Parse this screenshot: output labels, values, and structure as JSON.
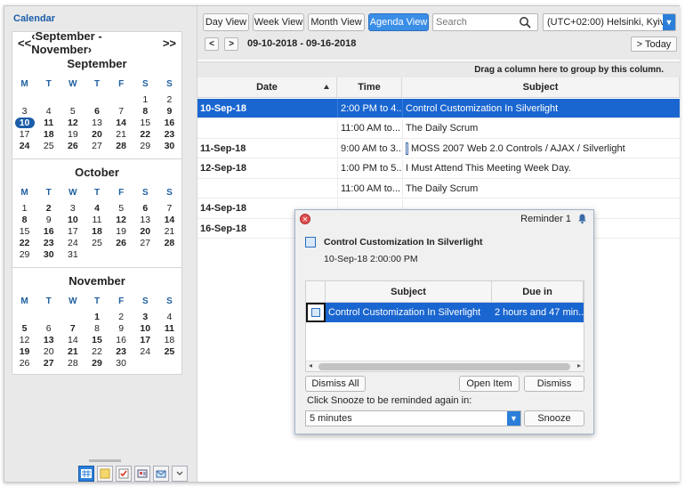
{
  "sidebar": {
    "title": "Calendar",
    "nav_prev": "<<",
    "nav_range": "‹September - November›",
    "nav_next": ">>",
    "dow": [
      "M",
      "T",
      "W",
      "T",
      "F",
      "S",
      "S"
    ],
    "months": [
      {
        "name": "September",
        "days": [
          {
            "t": "",
            "b": false
          },
          {
            "t": "",
            "b": false
          },
          {
            "t": "",
            "b": false
          },
          {
            "t": "",
            "b": false
          },
          {
            "t": "",
            "b": false
          },
          {
            "t": "1",
            "b": false
          },
          {
            "t": "2",
            "b": false
          },
          {
            "t": "3",
            "b": false
          },
          {
            "t": "4",
            "b": false
          },
          {
            "t": "5",
            "b": false
          },
          {
            "t": "6",
            "b": true
          },
          {
            "t": "7",
            "b": false
          },
          {
            "t": "8",
            "b": true
          },
          {
            "t": "9",
            "b": true
          },
          {
            "t": "10",
            "b": true,
            "today": true
          },
          {
            "t": "11",
            "b": true
          },
          {
            "t": "12",
            "b": true
          },
          {
            "t": "13",
            "b": false
          },
          {
            "t": "14",
            "b": true
          },
          {
            "t": "15",
            "b": false
          },
          {
            "t": "16",
            "b": true
          },
          {
            "t": "17",
            "b": false
          },
          {
            "t": "18",
            "b": true
          },
          {
            "t": "19",
            "b": false
          },
          {
            "t": "20",
            "b": true
          },
          {
            "t": "21",
            "b": false
          },
          {
            "t": "22",
            "b": true
          },
          {
            "t": "23",
            "b": true
          },
          {
            "t": "24",
            "b": true
          },
          {
            "t": "25",
            "b": false
          },
          {
            "t": "26",
            "b": true
          },
          {
            "t": "27",
            "b": false
          },
          {
            "t": "28",
            "b": true
          },
          {
            "t": "29",
            "b": false
          },
          {
            "t": "30",
            "b": true
          }
        ]
      },
      {
        "name": "October",
        "days": [
          {
            "t": "1",
            "b": false
          },
          {
            "t": "2",
            "b": true
          },
          {
            "t": "3",
            "b": false
          },
          {
            "t": "4",
            "b": true
          },
          {
            "t": "5",
            "b": false
          },
          {
            "t": "6",
            "b": true
          },
          {
            "t": "7",
            "b": false
          },
          {
            "t": "8",
            "b": true
          },
          {
            "t": "9",
            "b": false
          },
          {
            "t": "10",
            "b": true
          },
          {
            "t": "11",
            "b": false
          },
          {
            "t": "12",
            "b": true
          },
          {
            "t": "13",
            "b": false
          },
          {
            "t": "14",
            "b": true
          },
          {
            "t": "15",
            "b": false
          },
          {
            "t": "16",
            "b": true
          },
          {
            "t": "17",
            "b": false
          },
          {
            "t": "18",
            "b": true
          },
          {
            "t": "19",
            "b": false
          },
          {
            "t": "20",
            "b": true
          },
          {
            "t": "21",
            "b": false
          },
          {
            "t": "22",
            "b": true
          },
          {
            "t": "23",
            "b": true
          },
          {
            "t": "24",
            "b": false
          },
          {
            "t": "25",
            "b": false
          },
          {
            "t": "26",
            "b": true
          },
          {
            "t": "27",
            "b": false
          },
          {
            "t": "28",
            "b": true
          },
          {
            "t": "29",
            "b": false
          },
          {
            "t": "30",
            "b": true
          },
          {
            "t": "31",
            "b": false
          }
        ]
      },
      {
        "name": "November",
        "days": [
          {
            "t": "",
            "b": false
          },
          {
            "t": "",
            "b": false
          },
          {
            "t": "",
            "b": false
          },
          {
            "t": "1",
            "b": true
          },
          {
            "t": "2",
            "b": false
          },
          {
            "t": "3",
            "b": true
          },
          {
            "t": "4",
            "b": false
          },
          {
            "t": "5",
            "b": true
          },
          {
            "t": "6",
            "b": false
          },
          {
            "t": "7",
            "b": true
          },
          {
            "t": "8",
            "b": false
          },
          {
            "t": "9",
            "b": false
          },
          {
            "t": "10",
            "b": true
          },
          {
            "t": "11",
            "b": true
          },
          {
            "t": "12",
            "b": false
          },
          {
            "t": "13",
            "b": true
          },
          {
            "t": "14",
            "b": false
          },
          {
            "t": "15",
            "b": true
          },
          {
            "t": "16",
            "b": false
          },
          {
            "t": "17",
            "b": true
          },
          {
            "t": "18",
            "b": false
          },
          {
            "t": "19",
            "b": true
          },
          {
            "t": "20",
            "b": false
          },
          {
            "t": "21",
            "b": true
          },
          {
            "t": "22",
            "b": false
          },
          {
            "t": "23",
            "b": true
          },
          {
            "t": "24",
            "b": false
          },
          {
            "t": "25",
            "b": true
          },
          {
            "t": "26",
            "b": false
          },
          {
            "t": "27",
            "b": true
          },
          {
            "t": "28",
            "b": false
          },
          {
            "t": "29",
            "b": true
          },
          {
            "t": "30",
            "b": false
          }
        ]
      }
    ],
    "footer_icons": [
      "calendar-icon",
      "notes-icon",
      "tasks-icon",
      "contacts-icon",
      "mail-icon",
      "more-icon"
    ]
  },
  "toolbar": {
    "views": [
      "Day View",
      "Week View",
      "Month View",
      "Agenda View"
    ],
    "active_view": "Agenda View",
    "search_placeholder": "Search",
    "timezone": "(UTC+02:00) Helsinki, Kyiv,",
    "prev": "<",
    "next": ">",
    "range": "09-10-2018 - 09-16-2018",
    "today": "> Today"
  },
  "grid": {
    "group_hint": "Drag a column here to group by this column.",
    "columns": [
      "Date",
      "Time",
      "Subject"
    ],
    "rows": [
      {
        "date": "10-Sep-18",
        "time": "2:00 PM to 4...",
        "subject": "Control Customization In Silverlight",
        "selected": true
      },
      {
        "date": "",
        "time": "11:00 AM to...",
        "subject": "The Daily Scrum",
        "selected": false
      },
      {
        "date": "11-Sep-18",
        "time": "9:00 AM to 3...",
        "subject": "MOSS 2007 Web 2.0 Controls / AJAX / Silverlight",
        "selected": false,
        "tick": true
      },
      {
        "date": "12-Sep-18",
        "time": "1:00 PM to 5...",
        "subject": "I Must Attend This Meeting Week Day.",
        "selected": false
      },
      {
        "date": "",
        "time": "11:00 AM to...",
        "subject": "The Daily Scrum",
        "selected": false
      },
      {
        "date": "14-Sep-18",
        "time": "",
        "subject": "",
        "selected": false
      },
      {
        "date": "16-Sep-18",
        "time": "",
        "subject": "",
        "selected": false
      }
    ]
  },
  "reminder": {
    "title": "Reminder 1",
    "subject": "Control Customization In Silverlight",
    "datetime": "10-Sep-18 2:00:00 PM",
    "columns": [
      "Subject",
      "Due in"
    ],
    "row": {
      "subject": "Control Customization In Silverlight",
      "due": "2 hours and 47 min..."
    },
    "dismiss_all": "Dismiss All",
    "open_item": "Open Item",
    "dismiss": "Dismiss",
    "snooze_label": "Click Snooze to be reminded again in:",
    "snooze_value": "5 minutes",
    "snooze": "Snooze"
  },
  "colors": {
    "accent": "#1a66d0",
    "link": "#1a5ca8"
  }
}
